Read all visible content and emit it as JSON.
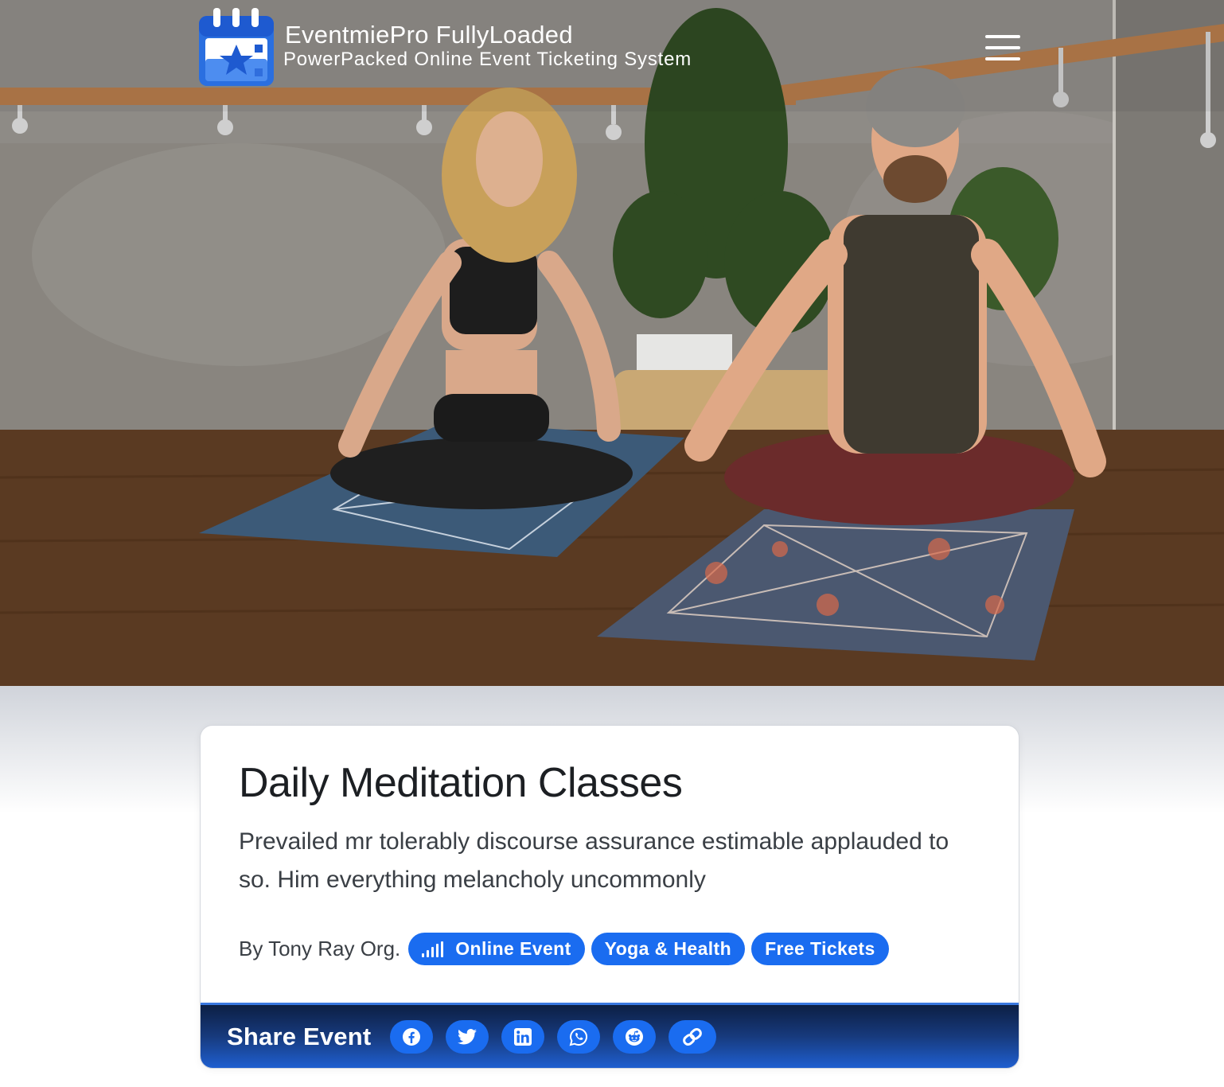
{
  "header": {
    "title": "EventmiePro FullyLoaded",
    "subtitle": "PowerPacked Online Event Ticketing System"
  },
  "event": {
    "title": "Daily Meditation Classes",
    "description": "Prevailed mr tolerably discourse assurance estimable applauded to so. Him everything melancholy uncommonly",
    "organizer": "By Tony Ray Org.",
    "tags": {
      "online": "Online Event",
      "category": "Yoga & Health",
      "price": "Free Tickets"
    }
  },
  "share": {
    "label": "Share Event",
    "buttons": [
      "facebook-icon",
      "twitter-icon",
      "linkedin-icon",
      "whatsapp-icon",
      "reddit-icon",
      "link-icon"
    ]
  },
  "colors": {
    "accent": "#1a6cf0",
    "share_bar_dark": "#0c1f44"
  }
}
